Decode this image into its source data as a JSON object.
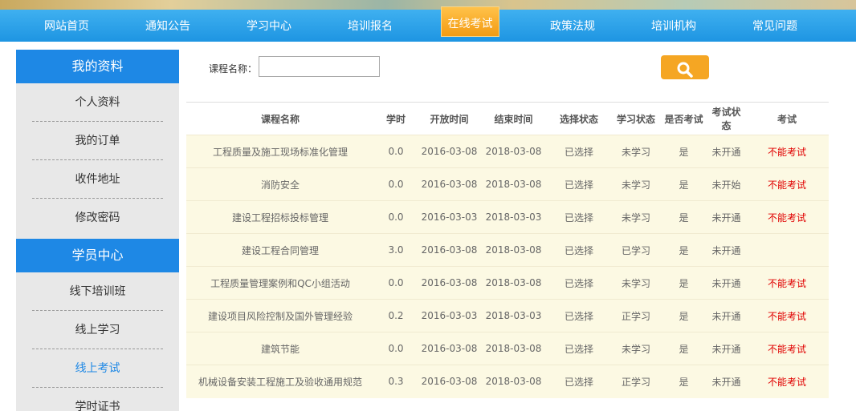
{
  "nav": {
    "items": [
      "网站首页",
      "通知公告",
      "学习中心",
      "培训报名",
      "在线考试",
      "政策法规",
      "培训机构",
      "常见问题"
    ],
    "active_index": 4
  },
  "sidebar": {
    "section1_title": "我的资料",
    "section1_items": [
      "个人资料",
      "我的订单",
      "收件地址",
      "修改密码"
    ],
    "section2_title": "学员中心",
    "section2_items": [
      "线下培训班",
      "线上学习",
      "线上考试",
      "学时证书"
    ],
    "current_item": "线上考试"
  },
  "search": {
    "label": "课程名称：",
    "value": "",
    "placeholder": "",
    "button_icon": "search-icon"
  },
  "table": {
    "headers": [
      "课程名称",
      "学时",
      "开放时间",
      "结束时间",
      "选择状态",
      "学习状态",
      "是否考试",
      "考试状态",
      "考试"
    ],
    "rows": [
      [
        "工程质量及施工现场标准化管理",
        "0.0",
        "2016-03-08",
        "2018-03-08",
        "已选择",
        "未学习",
        "是",
        "未开通",
        "不能考试"
      ],
      [
        "消防安全",
        "0.0",
        "2016-03-08",
        "2018-03-08",
        "已选择",
        "未学习",
        "是",
        "未开始",
        "不能考试"
      ],
      [
        "建设工程招标投标管理",
        "0.0",
        "2016-03-03",
        "2018-03-03",
        "已选择",
        "未学习",
        "是",
        "未开通",
        "不能考试"
      ],
      [
        "建设工程合同管理",
        "3.0",
        "2016-03-08",
        "2018-03-08",
        "已选择",
        "已学习",
        "是",
        "未开通",
        ""
      ],
      [
        "工程质量管理案例和QC小组活动",
        "0.0",
        "2016-03-08",
        "2018-03-08",
        "已选择",
        "未学习",
        "是",
        "未开通",
        "不能考试"
      ],
      [
        "建设项目风险控制及国外管理经验",
        "0.2",
        "2016-03-03",
        "2018-03-03",
        "已选择",
        "正学习",
        "是",
        "未开通",
        "不能考试"
      ],
      [
        "建筑节能",
        "0.0",
        "2016-03-08",
        "2018-03-08",
        "已选择",
        "未学习",
        "是",
        "未开通",
        "不能考试"
      ],
      [
        "机械设备安装工程施工及验收通用规范",
        "0.3",
        "2016-03-08",
        "2018-03-08",
        "已选择",
        "正学习",
        "是",
        "未开通",
        "不能考试"
      ]
    ]
  },
  "colors": {
    "nav_blue": "#1e95e2",
    "active_orange": "#f39b12",
    "sidebar_head": "#1e88e5",
    "row_bg": "#fcf9e3",
    "exam_red": "#e00000"
  }
}
